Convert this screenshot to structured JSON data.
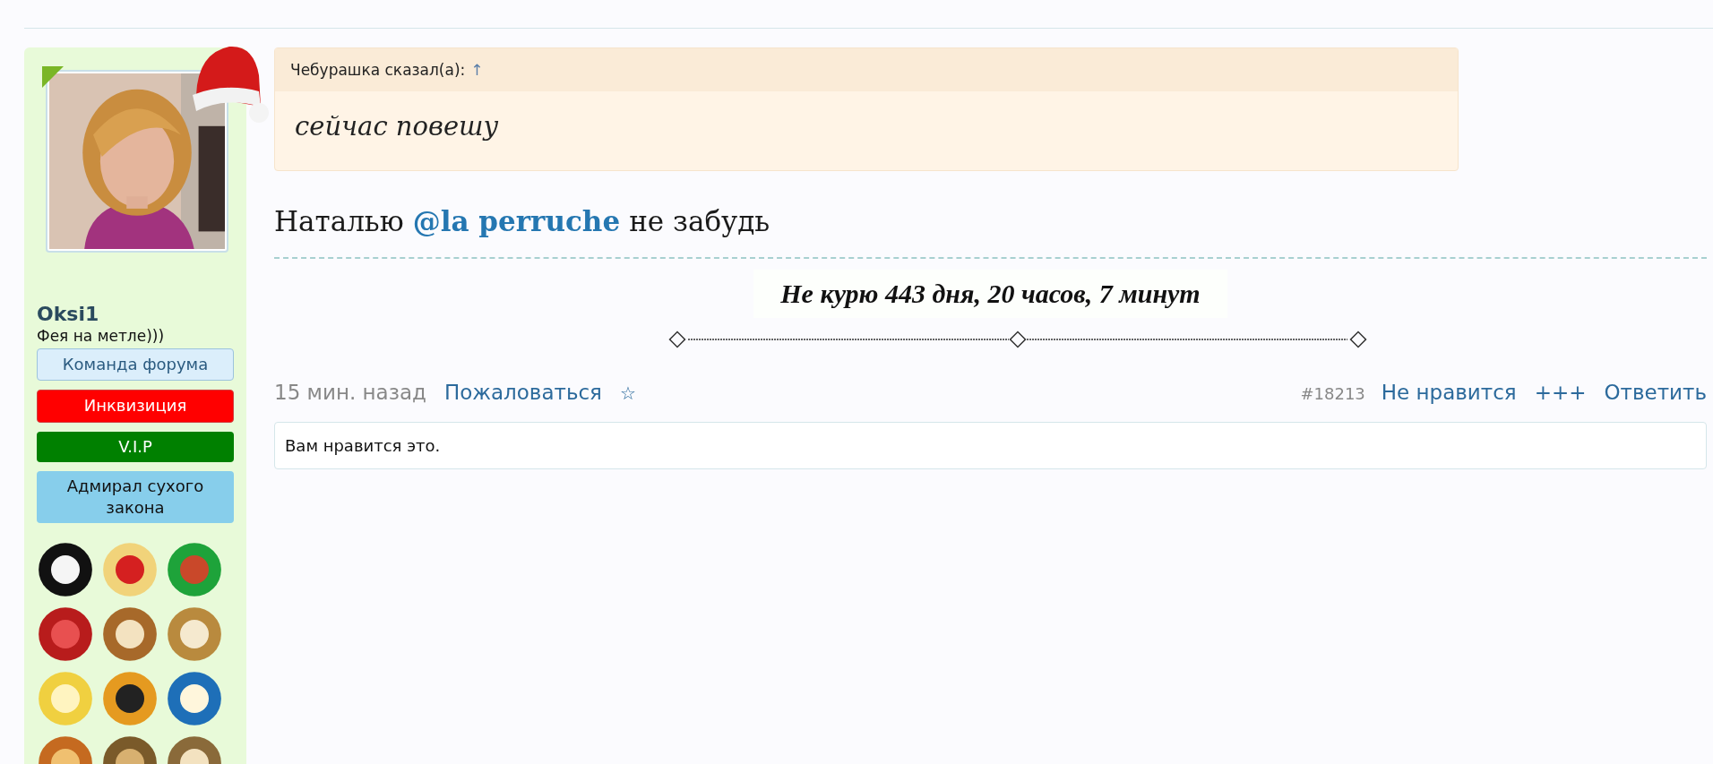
{
  "user": {
    "name": "Oksi1",
    "title": "Фея на метле)))",
    "badges": [
      {
        "label": "Команда форума",
        "kind": "team"
      },
      {
        "label": "Инквизиция",
        "kind": "inquisition"
      },
      {
        "label": "V.I.P",
        "kind": "vip"
      },
      {
        "label": "Адмирал сухого закона",
        "kind": "title"
      }
    ]
  },
  "quote": {
    "author": "Чебурашка сказал(а):",
    "jump": "↑",
    "text": "сейчас повешу"
  },
  "message": {
    "before": "Наталью",
    "mention": "@la perruche",
    "after": "не забудь"
  },
  "signature": {
    "text": "Не курю  443 дня, 20 часов, 7 минут"
  },
  "footer": {
    "time": "15 мин. назад",
    "report": "Пожаловаться",
    "bookmark": "☆",
    "post_number": "#18213",
    "dislike": "Не нравится",
    "plus": "+++",
    "reply": "Ответить"
  },
  "likes": {
    "text": "Вам нравится это."
  }
}
